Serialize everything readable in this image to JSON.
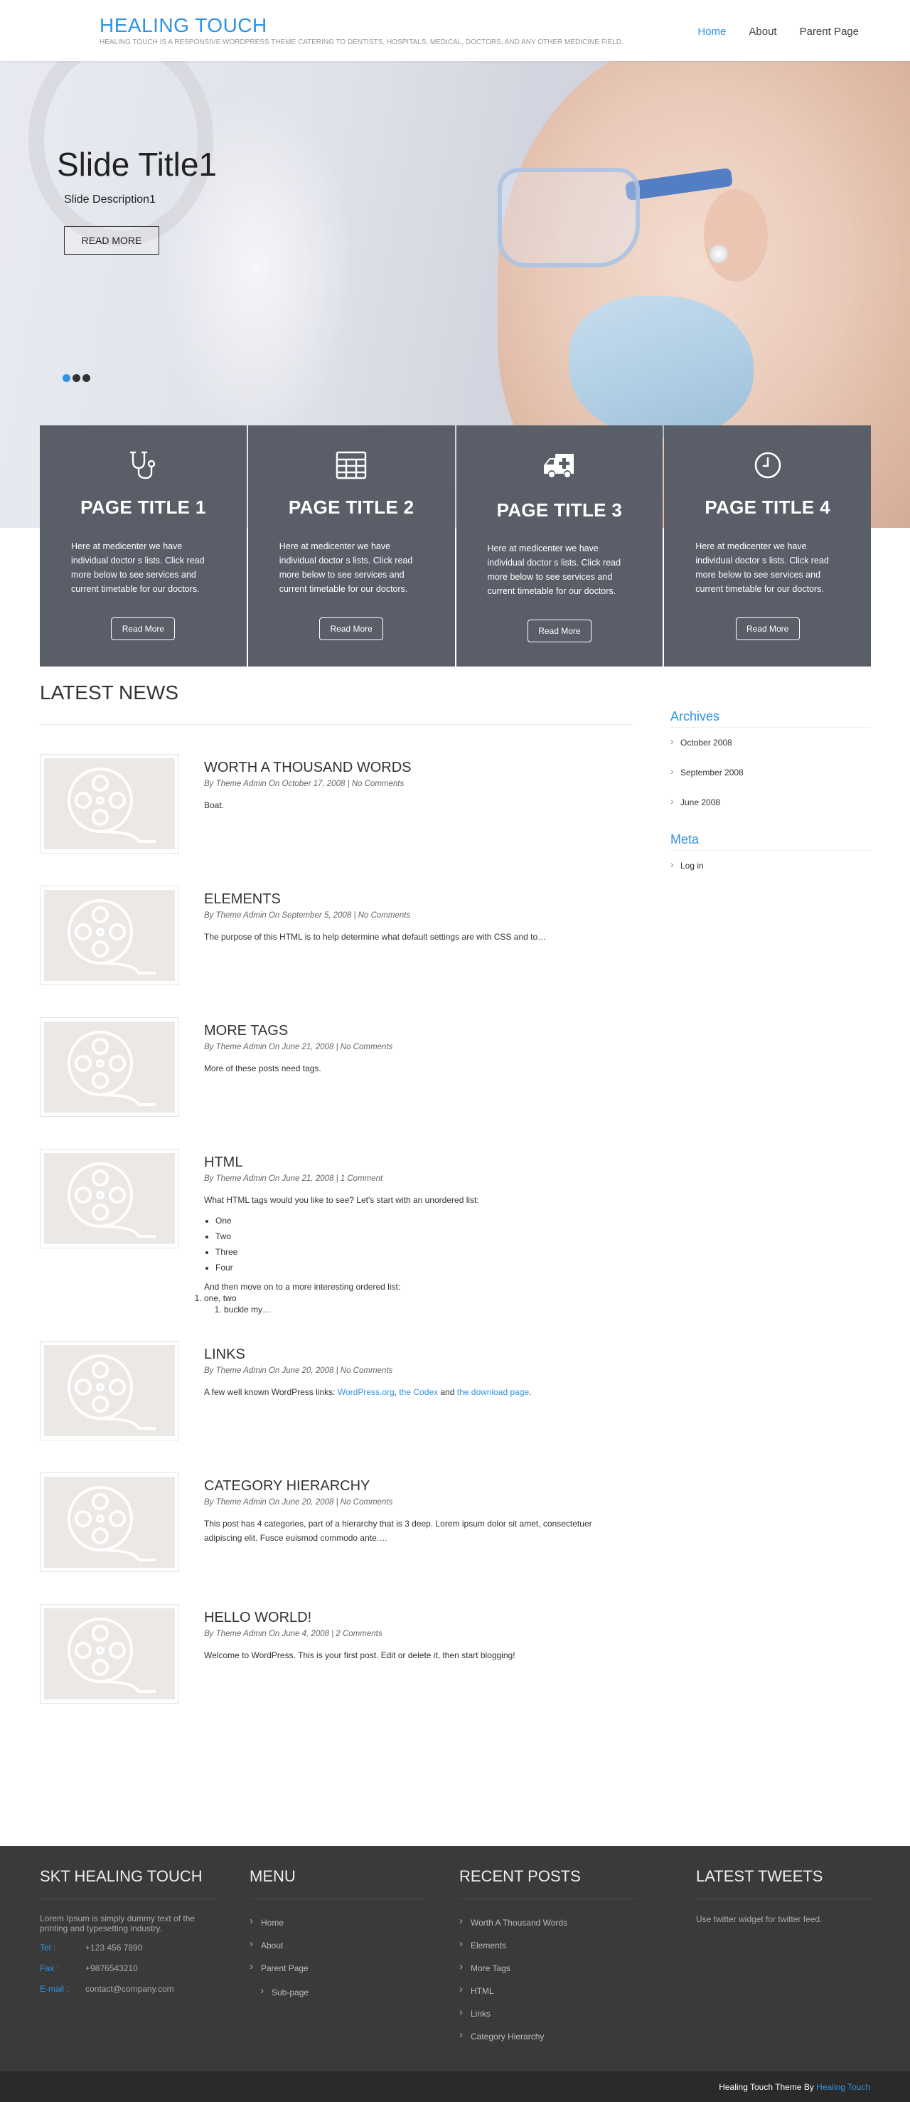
{
  "header": {
    "site_title": "HEALING TOUCH",
    "tagline": "HEALING TOUCH IS A RESPONSIVE WORDPRESS THEME CATERING TO DENTISTS, HOSPITALS, MEDICAL, DOCTORS, AND ANY OTHER MEDICINE FIELD.",
    "nav": [
      "Home",
      "About",
      "Parent Page"
    ],
    "active_nav": "Home"
  },
  "slider": {
    "title": "Slide Title1",
    "description": "Slide Description1",
    "button": "READ MORE",
    "slide_count": 3,
    "active_slide": 1
  },
  "services": [
    {
      "icon": "stethoscope-icon",
      "title": "PAGE TITLE 1",
      "text": "Here at medicenter we have individual doctor s lists. Click read more below to see services and current timetable for our doctors.",
      "button": "Read More"
    },
    {
      "icon": "grid-table-icon",
      "title": "PAGE TITLE 2",
      "text": "Here at medicenter we have individual doctor s lists. Click read more below to see services and current timetable for our doctors.",
      "button": "Read More"
    },
    {
      "icon": "ambulance-icon",
      "title": "PAGE TITLE 3",
      "text": "Here at medicenter we have individual doctor s lists. Click read more below to see services and current timetable for our doctors.",
      "button": "Read More"
    },
    {
      "icon": "clock-icon",
      "title": "PAGE TITLE 4",
      "text": "Here at medicenter we have individual doctor s lists. Click read more below to see services and current timetable for our doctors.",
      "button": "Read More"
    }
  ],
  "latest_news": {
    "heading": "LATEST NEWS",
    "posts": [
      {
        "title": "WORTH A THOUSAND WORDS",
        "meta": "By Theme Admin On October 17, 2008 | No Comments",
        "excerpt": "Boat."
      },
      {
        "title": "ELEMENTS",
        "meta": "By Theme Admin On September 5, 2008 | No Comments",
        "excerpt": "The purpose of this HTML is to help determine what default settings are with CSS and to…"
      },
      {
        "title": "MORE TAGS",
        "meta": "By Theme Admin On June 21, 2008 | No Comments",
        "excerpt": "More of these posts need tags."
      },
      {
        "title": "HTML",
        "meta": "By Theme Admin On June 21, 2008 | 1 Comment",
        "excerpt": "What HTML tags would you like to see? Let's start with an unordered list:",
        "list": [
          "One",
          "Two",
          "Three",
          "Four"
        ],
        "after": "And then move on to a more interesting ordered list:",
        "ol_outer": "one, two",
        "ol_inner": "buckle my…"
      },
      {
        "title": "LINKS",
        "meta": "By Theme Admin On June 20, 2008 | No Comments",
        "excerpt_pre": "A few well known WordPress links: ",
        "link1": "WordPress.org",
        "sep1": ", ",
        "link2": "the Codex",
        "sep2": " and ",
        "link3": "the download page",
        "end": "."
      },
      {
        "title": "CATEGORY HIERARCHY",
        "meta": "By Theme Admin On June 20, 2008 | No Comments",
        "excerpt": "This post has 4 categories, part of a hierarchy that is 3 deep. Lorem ipsum dolor sit amet, consectetuer adipiscing elit. Fusce euismod commodo ante.…"
      },
      {
        "title": "HELLO WORLD!",
        "meta": "By Theme Admin On June 4, 2008 | 2 Comments",
        "excerpt": "Welcome to WordPress. This is your first post. Edit or delete it, then start blogging!"
      }
    ]
  },
  "sidebar": {
    "archives_heading": "Archives",
    "archives": [
      "October 2008",
      "September 2008",
      "June 2008"
    ],
    "meta_heading": "Meta",
    "meta": [
      "Log in"
    ]
  },
  "footer": {
    "about_heading": "SKT HEALING TOUCH",
    "about_text": "Lorem Ipsum is simply dummy text of the printing and typesetting industry.",
    "tel_label": "Tel :",
    "tel": "+123 456 7890",
    "fax_label": "Fax :",
    "fax": "+9876543210",
    "email_label": "E-mail :",
    "email": "contact@company.com",
    "menu_heading": "MENU",
    "menu": [
      "Home",
      "About",
      "Parent Page"
    ],
    "submenu": "Sub-page",
    "recent_heading": "RECENT POSTS",
    "recent": [
      "Worth A Thousand Words",
      "Elements",
      "More Tags",
      "HTML",
      "Links",
      "Category Hierarchy"
    ],
    "tweets_heading": "LATEST TWEETS",
    "tweets_text": "Use twitter widget for twitter feed."
  },
  "credit": {
    "text": "Healing Touch Theme By ",
    "link": "Healing Touch"
  },
  "colors": {
    "accent": "#2e93e0",
    "service_bg": "#5a5e68",
    "footer_bg": "#3a3a3a",
    "bottom_bg": "#2a2a2a"
  }
}
